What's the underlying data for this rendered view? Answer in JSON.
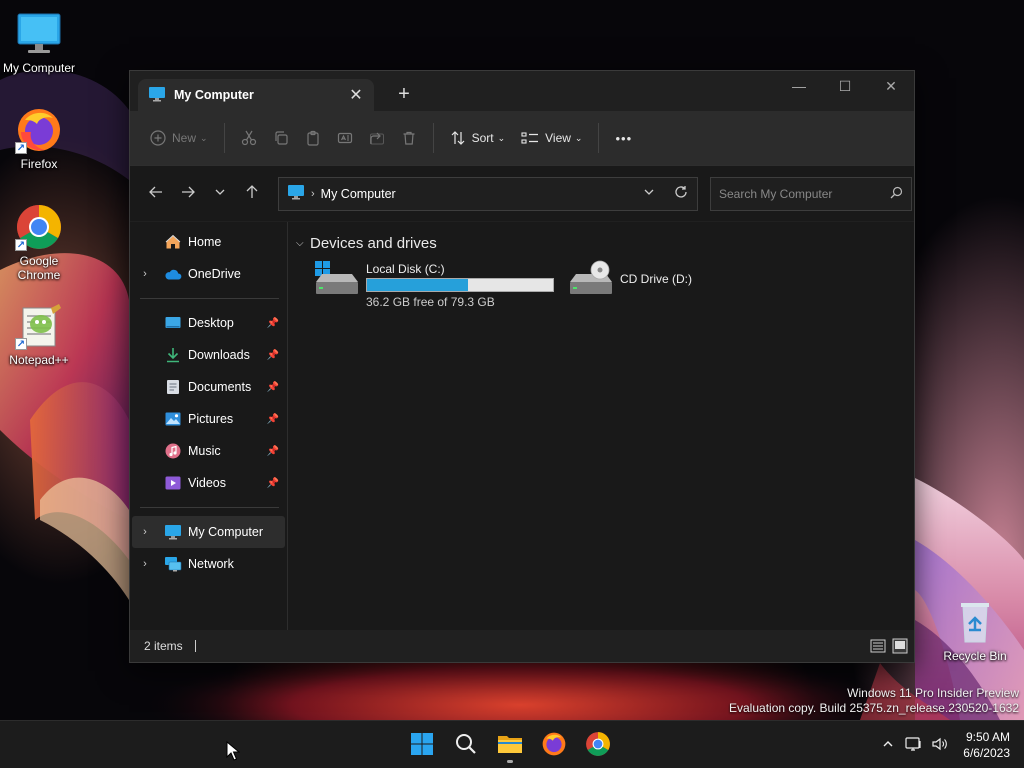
{
  "desktop": {
    "icons": [
      {
        "label": "My Computer"
      },
      {
        "label": "Firefox"
      },
      {
        "label": "Google Chrome"
      },
      {
        "label": "Notepad++"
      },
      {
        "label": "Recycle Bin"
      }
    ],
    "watermark": {
      "line1": "Windows 11 Pro Insider Preview",
      "line2": "Evaluation copy. Build 25375.zn_release.230520-1632"
    }
  },
  "window": {
    "tab_title": "My Computer",
    "tab_close": "✕",
    "new_tab": "+",
    "controls": {
      "minimize": "—",
      "maximize": "☐",
      "close": "✕"
    }
  },
  "toolbar": {
    "new_label": "New",
    "sort_label": "Sort",
    "view_label": "View",
    "more_label": "•••"
  },
  "address": {
    "path": "My Computer",
    "search_placeholder": "Search My Computer"
  },
  "sidebar": {
    "home": "Home",
    "onedrive": "OneDrive",
    "quick_access": [
      {
        "label": "Desktop"
      },
      {
        "label": "Downloads"
      },
      {
        "label": "Documents"
      },
      {
        "label": "Pictures"
      },
      {
        "label": "Music"
      },
      {
        "label": "Videos"
      }
    ],
    "my_computer": "My Computer",
    "network": "Network"
  },
  "content": {
    "group_title": "Devices and drives",
    "drives": [
      {
        "name": "Local Disk (C:)",
        "info": "36.2 GB free of 79.3 GB",
        "used_fraction": 0.543
      },
      {
        "name": "CD Drive (D:)"
      }
    ]
  },
  "status": {
    "items": "2 items"
  },
  "taskbar": {
    "time": "9:50 AM",
    "date": "6/6/2023"
  },
  "colors": {
    "accent": "#26a0da",
    "window_bg": "#202020",
    "taskbar_bg": "#1c1c1c"
  }
}
